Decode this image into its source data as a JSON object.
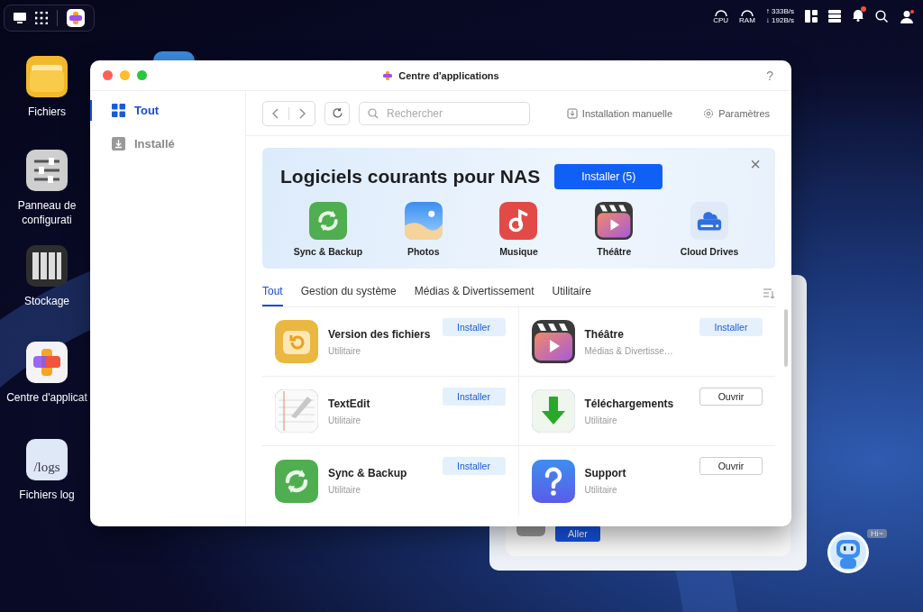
{
  "top_bar": {
    "cpu_label": "CPU",
    "ram_label": "RAM",
    "network_up": "↑ 333B/s",
    "network_down": "↓ 192B/s",
    "notification_badge": true
  },
  "desktop_icons": [
    {
      "kind": "folder",
      "label": "Fichiers"
    },
    {
      "kind": "settings",
      "label": "Panneau de configurati"
    },
    {
      "kind": "storage",
      "label": "Stockage"
    },
    {
      "kind": "appcenter",
      "label": "Centre d'applicat"
    },
    {
      "kind": "logs",
      "label": "Fichiers log",
      "icon_text": "/logs"
    }
  ],
  "window": {
    "title": "Centre d'applications",
    "help": "?"
  },
  "sidebar": [
    {
      "label": "Tout",
      "selected": true
    },
    {
      "label": "Installé",
      "selected": false
    }
  ],
  "toolbar": {
    "search_placeholder": "Rechercher",
    "actions": [
      {
        "kind": "install",
        "label": "Installation manuelle"
      },
      {
        "kind": "settings",
        "label": "Paramètres"
      }
    ]
  },
  "banner": {
    "title": "Logiciels courants pour NAS",
    "button": "Installer (5)",
    "close": "×",
    "apps": [
      {
        "label": "Sync & Backup"
      },
      {
        "label": "Photos"
      },
      {
        "label": "Musique"
      },
      {
        "label": "Théâtre"
      },
      {
        "label": "Cloud Drives"
      }
    ]
  },
  "tabs": [
    {
      "label": "Tout",
      "selected": true
    },
    {
      "label": "Gestion du système",
      "selected": false
    },
    {
      "label": "Médias & Divertissement",
      "selected": false
    },
    {
      "label": "Utilitaire",
      "selected": false
    }
  ],
  "apps": [
    {
      "name": "Version des fichiers",
      "category": "Utilitaire",
      "action": {
        "kind": "install",
        "label": "Installer"
      }
    },
    {
      "name": "Théâtre",
      "category": "Médias & Divertisse…",
      "action": {
        "kind": "install",
        "label": "Installer"
      }
    },
    {
      "name": "TextEdit",
      "category": "Utilitaire",
      "action": {
        "kind": "install",
        "label": "Installer"
      }
    },
    {
      "name": "Téléchargements",
      "category": "Utilitaire",
      "action": {
        "kind": "open",
        "label": "Ouvrir"
      }
    },
    {
      "name": "Sync & Backup",
      "category": "Utilitaire",
      "action": {
        "kind": "install",
        "label": "Installer"
      }
    },
    {
      "name": "Support",
      "category": "Utilitaire",
      "action": {
        "kind": "open",
        "label": "Ouvrir"
      }
    }
  ],
  "behind_panel": {
    "button": "Aller"
  },
  "assistant": {
    "bubble": "Hi~"
  }
}
